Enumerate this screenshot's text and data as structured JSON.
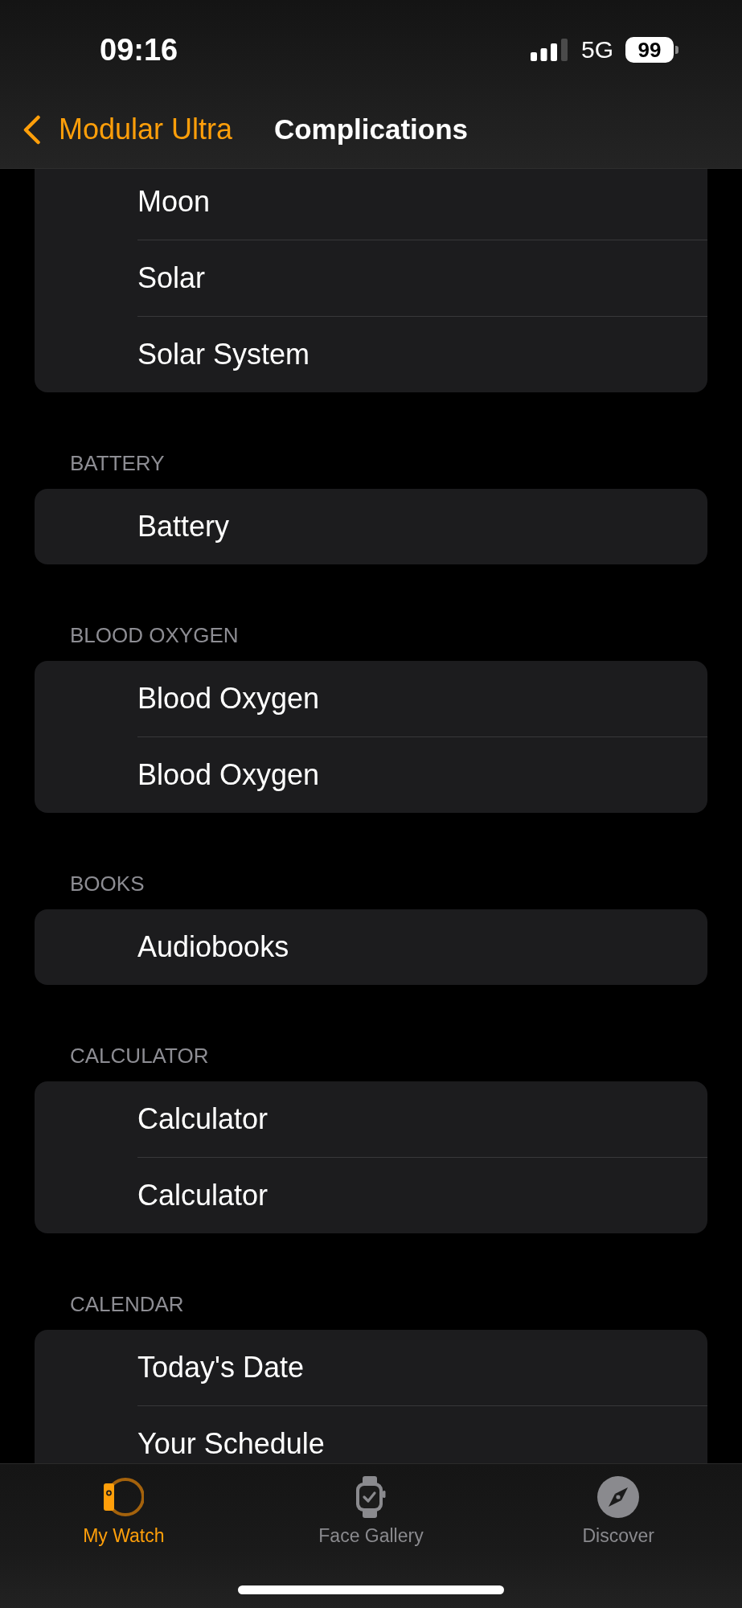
{
  "status_bar": {
    "time": "09:16",
    "network": "5G",
    "battery": "99"
  },
  "nav_bar": {
    "back_label": "Modular Ultra",
    "title": "Complications"
  },
  "sections": [
    {
      "items": [
        "Moon",
        "Solar",
        "Solar System"
      ]
    },
    {
      "header": "BATTERY",
      "items": [
        "Battery"
      ]
    },
    {
      "header": "BLOOD OXYGEN",
      "items": [
        "Blood Oxygen",
        "Blood Oxygen"
      ]
    },
    {
      "header": "BOOKS",
      "items": [
        "Audiobooks"
      ]
    },
    {
      "header": "CALCULATOR",
      "items": [
        "Calculator",
        "Calculator"
      ]
    },
    {
      "header": "CALENDAR",
      "items": [
        "Today's Date",
        "Your Schedule"
      ]
    }
  ],
  "tabs": [
    {
      "label": "My Watch",
      "selected": true
    },
    {
      "label": "Face Gallery",
      "selected": false
    },
    {
      "label": "Discover",
      "selected": false
    }
  ]
}
